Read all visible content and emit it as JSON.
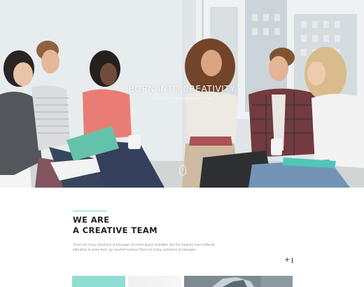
{
  "hero": {
    "title": "BORN INTO CREATIVITY",
    "subtitle": "Elaborate your imagination ideas"
  },
  "about": {
    "title_line1": "WE ARE",
    "title_line2": "A CREATIVE TEAM",
    "text": "There are many variations of passages of Lorem Ipsum available, but the majority have suffered alteration in some form, by injected humour There are many variations of passages.",
    "plus_label": "+"
  },
  "colors": {
    "accent": "#74d4c8",
    "tile_teal": "#8fded3"
  },
  "icons": {
    "scroll": "scroll-mouse-icon",
    "plus": "plus-icon"
  }
}
